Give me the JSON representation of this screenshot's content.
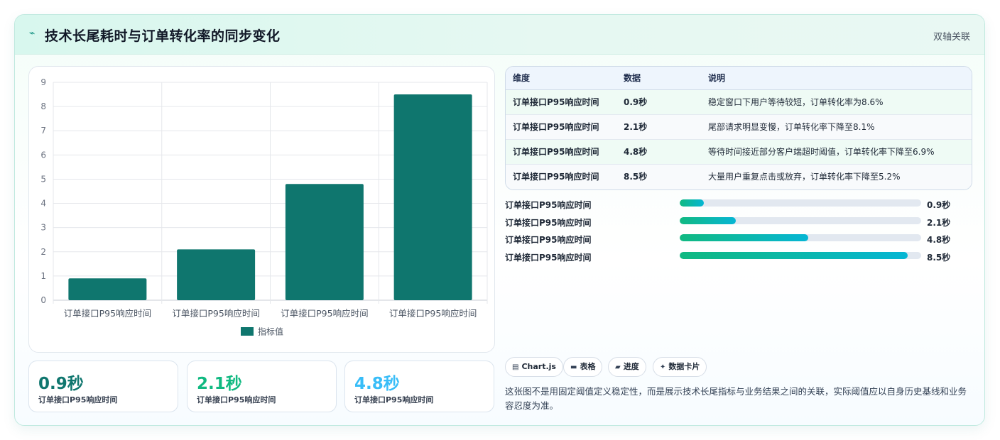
{
  "header": {
    "title": "技术长尾耗时与订单转化率的同步变化",
    "tag": "双轴关联"
  },
  "chart_data": {
    "type": "bar",
    "categories": [
      "订单接口P95响应时间",
      "订单接口P95响应时间",
      "订单接口P95响应时间",
      "订单接口P95响应时间"
    ],
    "series": [
      {
        "name": "指标值",
        "values": [
          0.9,
          2.1,
          4.8,
          8.5
        ]
      }
    ],
    "yticks": [
      "0",
      "1",
      "2",
      "3",
      "4",
      "5",
      "6",
      "7",
      "8",
      "9"
    ],
    "ylim": [
      0,
      9
    ],
    "grid": true,
    "legend": "bottom",
    "colors": {
      "bar": "#0f766e"
    }
  },
  "table": {
    "headers": [
      "维度",
      "数据",
      "说明"
    ],
    "rows": [
      {
        "dim": "订单接口P95响应时间",
        "val": "0.9秒",
        "desc": "稳定窗口下用户等待较短，订单转化率为8.6%"
      },
      {
        "dim": "订单接口P95响应时间",
        "val": "2.1秒",
        "desc": "尾部请求明显变慢，订单转化率下降至8.1%"
      },
      {
        "dim": "订单接口P95响应时间",
        "val": "4.8秒",
        "desc": "等待时间接近部分客户端超时阈值，订单转化率下降至6.9%"
      },
      {
        "dim": "订单接口P95响应时间",
        "val": "8.5秒",
        "desc": "大量用户重复点击或放弃，订单转化率下降至5.2%"
      }
    ]
  },
  "progress": {
    "max": 9,
    "items": [
      {
        "label": "订单接口P95响应时间",
        "value": 0.9,
        "value_text": "0.9秒"
      },
      {
        "label": "订单接口P95响应时间",
        "value": 2.1,
        "value_text": "2.1秒"
      },
      {
        "label": "订单接口P95响应时间",
        "value": 4.8,
        "value_text": "4.8秒"
      },
      {
        "label": "订单接口P95响应时间",
        "value": 8.5,
        "value_text": "8.5秒"
      }
    ]
  },
  "chips": [
    {
      "icon": "chart-icon",
      "glyph": "▤",
      "label": "Chart.js"
    },
    {
      "icon": "table-icon",
      "glyph": "▬",
      "label": "表格"
    },
    {
      "icon": "progress-icon",
      "glyph": "▰",
      "label": "进度"
    },
    {
      "icon": "sparkle-icon",
      "glyph": "✦",
      "label": "数据卡片"
    }
  ],
  "note": "这张图不是用固定阈值定义稳定性，而是展示技术长尾指标与业务结果之间的关联，实际阈值应以自身历史基线和业务容忍度为准。",
  "stats": [
    {
      "value": "0.9秒",
      "label": "订单接口P95响应时间",
      "color": "#0f766e"
    },
    {
      "value": "2.1秒",
      "label": "订单接口P95响应时间",
      "color": "#10b981"
    },
    {
      "value": "4.8秒",
      "label": "订单接口P95响应时间",
      "color": "#38bdf8"
    }
  ]
}
